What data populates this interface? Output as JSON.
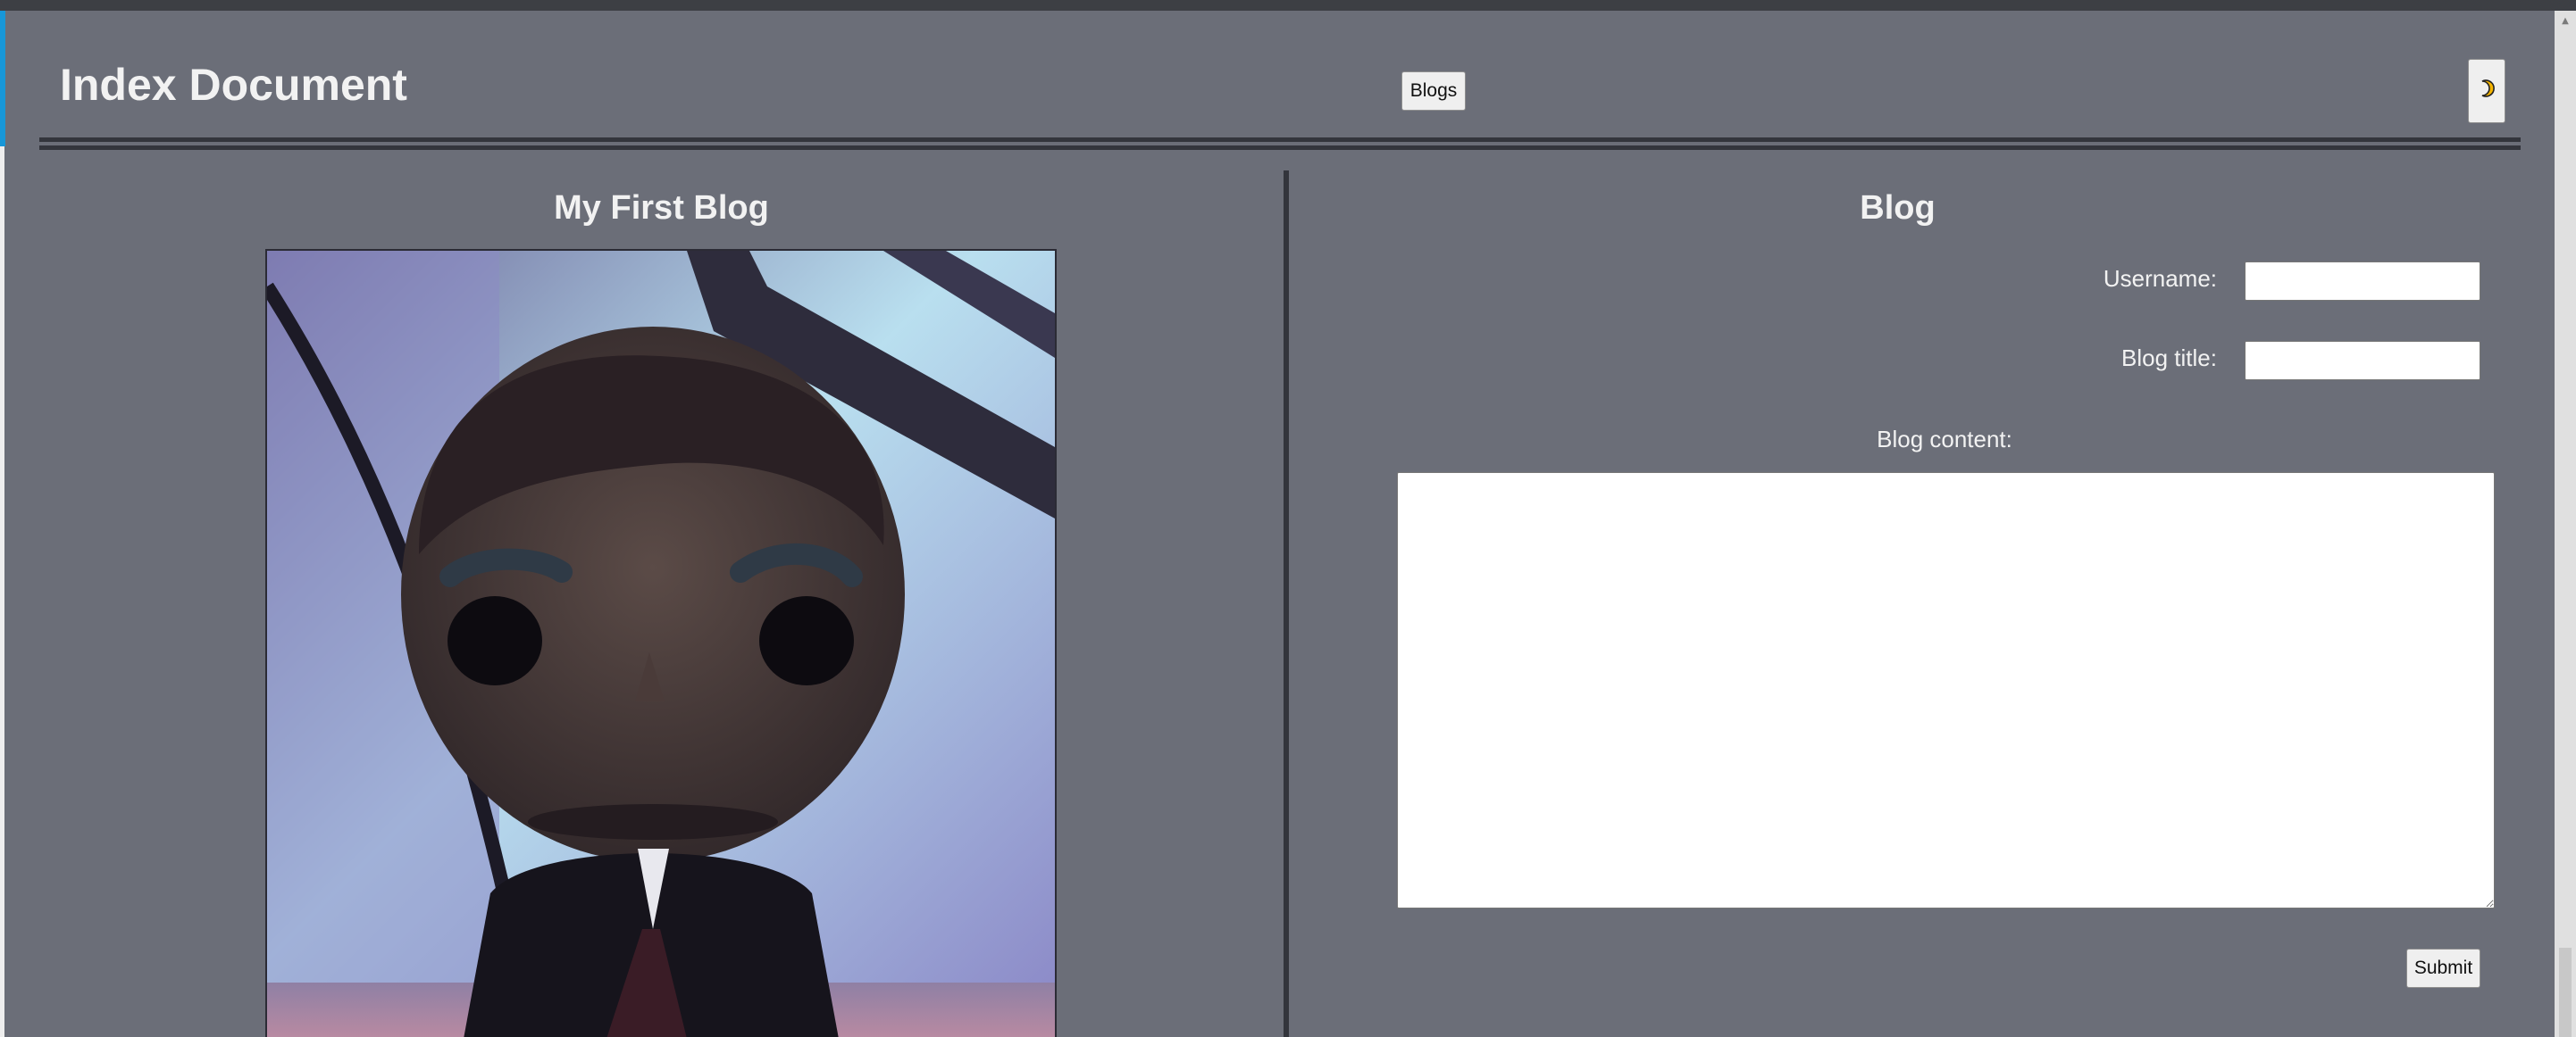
{
  "header": {
    "title": "Index Document",
    "blogs_button": "Blogs",
    "theme_toggle_icon": "moon-icon"
  },
  "post": {
    "title": "My First Blog",
    "image_icon": "figurine-photo"
  },
  "form": {
    "title": "Blog",
    "username_label": "Username:",
    "username_value": "",
    "blog_title_label": "Blog title:",
    "blog_title_value": "",
    "blog_content_label": "Blog content:",
    "blog_content_value": "",
    "submit_label": "Submit"
  },
  "colors": {
    "page_background": "#6b6e78",
    "divider": "#33353c",
    "heading_text": "#f2f2f2",
    "accent": "#1797d8",
    "moon": "#f4b400"
  }
}
